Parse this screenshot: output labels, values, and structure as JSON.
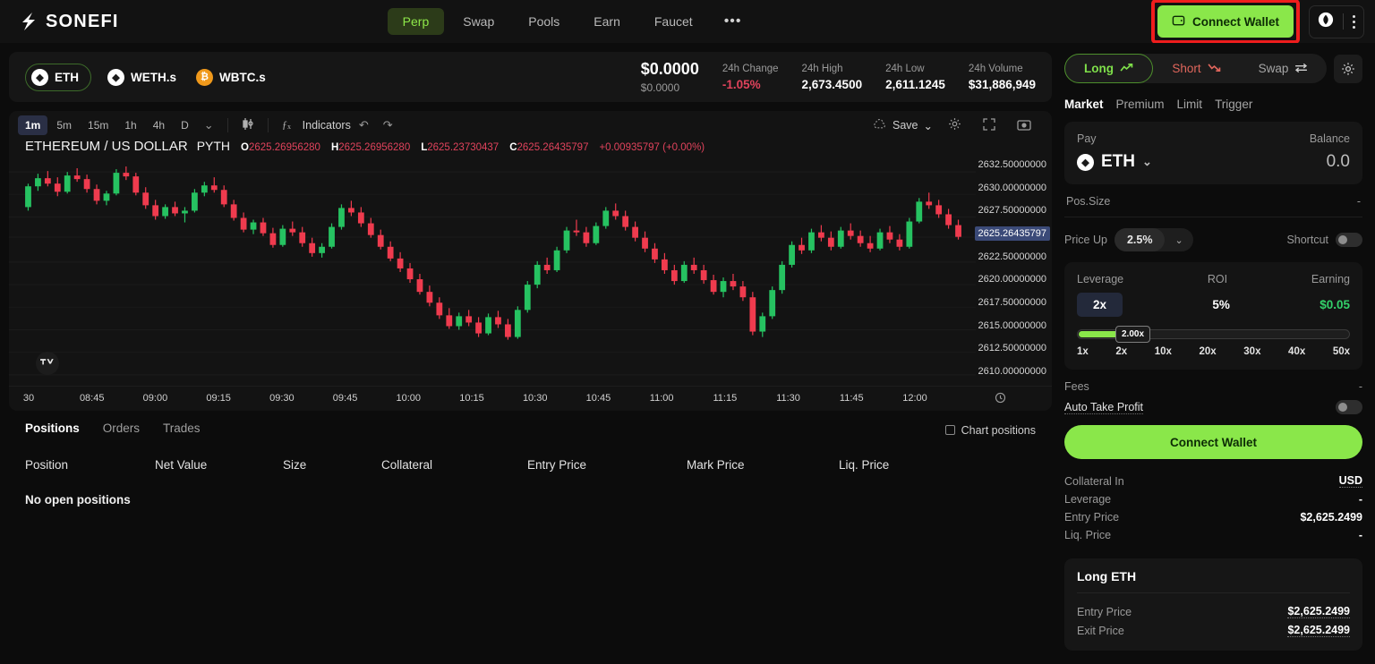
{
  "nav": {
    "brand": "SONEFI",
    "tabs": [
      {
        "label": "Perp",
        "active": true
      },
      {
        "label": "Swap",
        "active": false
      },
      {
        "label": "Pools",
        "active": false
      },
      {
        "label": "Earn",
        "active": false
      },
      {
        "label": "Faucet",
        "active": false
      }
    ],
    "more": "•••",
    "connect_wallet": "Connect Wallet",
    "wallet_icon": "wallet-icon",
    "network_icon": "network-icon",
    "kebab_icon": "kebab-menu-icon",
    "accent": "#8ae74a",
    "highlight_color": "#ef1d1d"
  },
  "market": {
    "tokens": [
      {
        "symbol": "ETH",
        "icon": "ethereum-icon",
        "active": true
      },
      {
        "symbol": "WETH.s",
        "icon": "ethereum-icon",
        "active": false
      },
      {
        "symbol": "WBTC.s",
        "icon": "bitcoin-icon",
        "active": false
      }
    ],
    "price": "$0.0000",
    "price_sub": "$0.0000",
    "stats": [
      {
        "label": "24h Change",
        "value": "-1.05%",
        "negative": true
      },
      {
        "label": "24h High",
        "value": "2,673.4500",
        "negative": false
      },
      {
        "label": "24h Low",
        "value": "2,611.1245",
        "negative": false
      },
      {
        "label": "24h Volume",
        "value": "$31,886,949",
        "negative": false
      }
    ]
  },
  "chart": {
    "timeframes": [
      {
        "label": "1m",
        "active": true
      },
      {
        "label": "5m",
        "active": false
      },
      {
        "label": "15m",
        "active": false
      },
      {
        "label": "1h",
        "active": false
      },
      {
        "label": "4h",
        "active": false
      },
      {
        "label": "D",
        "active": false
      }
    ],
    "caret": "⌄",
    "candle_icon": "candlestick-style-icon",
    "fx_icon": "fx-icon",
    "indicators": "Indicators",
    "undo_icon": "undo-icon",
    "redo_icon": "redo-icon",
    "save": "Save",
    "cloud_icon": "cloud-icon",
    "save_caret": "⌄",
    "settings_icon": "gear-icon",
    "fullscreen_icon": "fullscreen-icon",
    "camera_icon": "camera-icon",
    "legend_symbol": "ETHEREUM / US DOLLAR",
    "legend_source": "PYTH",
    "ohlc": {
      "o_label": "O",
      "o": "2625.26956280",
      "h_label": "H",
      "h": "2625.26956280",
      "l_label": "L",
      "l": "2625.23730437",
      "c_label": "C",
      "c": "2625.26435797",
      "change": "+0.00935797 (+0.00%)"
    },
    "current_price": "2625.26435797",
    "tv_logo": "tradingview-logo",
    "clock_icon": "timezone-clock-icon"
  },
  "chart_data": {
    "type": "candlestick",
    "title": "ETHEREUM / US DOLLAR · PYTH · 1m",
    "xlabel": "",
    "ylabel": "",
    "ylim": [
      2609.0,
      2633.5
    ],
    "price_ticks": [
      "2632.50000000",
      "2630.00000000",
      "2627.50000000",
      "2625.26435797",
      "2622.50000000",
      "2620.00000000",
      "2617.50000000",
      "2615.00000000",
      "2612.50000000",
      "2610.00000000"
    ],
    "time_ticks": [
      "30",
      "08:45",
      "09:00",
      "09:15",
      "09:30",
      "09:45",
      "10:00",
      "10:15",
      "10:30",
      "10:45",
      "11:00",
      "11:15",
      "11:30",
      "11:45",
      "12:00"
    ],
    "up_color": "#26c261",
    "down_color": "#ef3churchill",
    "ohlc_series": [
      [
        2628.6,
        2631.2,
        2628.2,
        2630.9
      ],
      [
        2630.9,
        2632.3,
        2630.4,
        2631.8
      ],
      [
        2631.8,
        2632.6,
        2630.9,
        2631.2
      ],
      [
        2631.2,
        2631.9,
        2629.8,
        2630.3
      ],
      [
        2630.3,
        2632.5,
        2630.1,
        2632.1
      ],
      [
        2632.1,
        2632.9,
        2631.4,
        2631.7
      ],
      [
        2631.7,
        2632.2,
        2630.2,
        2630.6
      ],
      [
        2630.6,
        2631.1,
        2628.9,
        2629.3
      ],
      [
        2629.3,
        2630.4,
        2628.8,
        2630.1
      ],
      [
        2630.1,
        2632.8,
        2629.9,
        2632.4
      ],
      [
        2632.4,
        2633.1,
        2631.6,
        2632.0
      ],
      [
        2632.0,
        2632.4,
        2629.9,
        2630.2
      ],
      [
        2630.2,
        2630.8,
        2628.4,
        2628.8
      ],
      [
        2628.8,
        2629.4,
        2627.2,
        2627.6
      ],
      [
        2627.6,
        2628.9,
        2627.3,
        2628.6
      ],
      [
        2628.6,
        2629.2,
        2627.6,
        2627.9
      ],
      [
        2627.9,
        2628.6,
        2626.9,
        2628.2
      ],
      [
        2628.2,
        2630.6,
        2628.0,
        2630.2
      ],
      [
        2630.2,
        2631.4,
        2629.8,
        2631.0
      ],
      [
        2631.0,
        2631.9,
        2630.2,
        2630.5
      ],
      [
        2630.5,
        2631.0,
        2628.6,
        2628.9
      ],
      [
        2628.9,
        2629.4,
        2627.1,
        2627.4
      ],
      [
        2627.4,
        2628.0,
        2625.8,
        2626.1
      ],
      [
        2626.1,
        2627.2,
        2625.6,
        2626.9
      ],
      [
        2626.9,
        2627.4,
        2625.4,
        2625.7
      ],
      [
        2625.7,
        2626.3,
        2624.1,
        2624.4
      ],
      [
        2624.4,
        2626.6,
        2624.2,
        2626.2
      ],
      [
        2626.2,
        2627.0,
        2625.4,
        2625.8
      ],
      [
        2625.8,
        2626.4,
        2624.2,
        2624.6
      ],
      [
        2624.6,
        2625.2,
        2623.1,
        2623.5
      ],
      [
        2623.5,
        2624.6,
        2623.0,
        2624.2
      ],
      [
        2624.2,
        2626.8,
        2624.0,
        2626.4
      ],
      [
        2626.4,
        2628.9,
        2626.1,
        2628.5
      ],
      [
        2628.5,
        2629.3,
        2627.6,
        2628.0
      ],
      [
        2628.0,
        2628.6,
        2626.4,
        2626.8
      ],
      [
        2626.8,
        2627.4,
        2625.2,
        2625.5
      ],
      [
        2625.5,
        2626.1,
        2623.9,
        2624.2
      ],
      [
        2624.2,
        2624.8,
        2622.6,
        2622.9
      ],
      [
        2622.9,
        2623.6,
        2621.4,
        2621.8
      ],
      [
        2621.8,
        2622.4,
        2620.2,
        2620.6
      ],
      [
        2620.6,
        2621.2,
        2618.9,
        2619.2
      ],
      [
        2619.2,
        2619.9,
        2617.6,
        2618.0
      ],
      [
        2618.0,
        2618.6,
        2616.2,
        2616.6
      ],
      [
        2616.6,
        2617.4,
        2615.1,
        2615.4
      ],
      [
        2615.4,
        2616.9,
        2615.0,
        2616.5
      ],
      [
        2616.5,
        2617.2,
        2615.4,
        2615.8
      ],
      [
        2615.8,
        2616.4,
        2614.2,
        2614.6
      ],
      [
        2614.6,
        2616.8,
        2614.4,
        2616.4
      ],
      [
        2616.4,
        2617.1,
        2615.2,
        2615.6
      ],
      [
        2615.6,
        2616.2,
        2613.9,
        2614.2
      ],
      [
        2614.2,
        2617.6,
        2614.0,
        2617.2
      ],
      [
        2617.2,
        2620.4,
        2616.9,
        2620.0
      ],
      [
        2620.0,
        2622.6,
        2619.6,
        2622.2
      ],
      [
        2622.2,
        2623.0,
        2621.2,
        2621.6
      ],
      [
        2621.6,
        2624.2,
        2621.4,
        2623.8
      ],
      [
        2623.8,
        2626.4,
        2623.5,
        2626.0
      ],
      [
        2626.0,
        2627.2,
        2625.4,
        2625.8
      ],
      [
        2625.8,
        2626.4,
        2624.2,
        2624.6
      ],
      [
        2624.6,
        2626.9,
        2624.4,
        2626.5
      ],
      [
        2626.5,
        2628.6,
        2626.2,
        2628.2
      ],
      [
        2628.2,
        2629.0,
        2627.2,
        2627.6
      ],
      [
        2627.6,
        2628.2,
        2626.0,
        2626.4
      ],
      [
        2626.4,
        2627.0,
        2624.8,
        2625.2
      ],
      [
        2625.2,
        2625.9,
        2623.6,
        2624.0
      ],
      [
        2624.0,
        2624.6,
        2622.4,
        2622.8
      ],
      [
        2622.8,
        2623.5,
        2621.2,
        2621.6
      ],
      [
        2621.6,
        2622.2,
        2620.0,
        2620.4
      ],
      [
        2620.4,
        2622.6,
        2620.2,
        2622.2
      ],
      [
        2622.2,
        2623.0,
        2621.2,
        2621.6
      ],
      [
        2621.6,
        2622.2,
        2620.1,
        2620.5
      ],
      [
        2620.5,
        2621.1,
        2618.9,
        2619.2
      ],
      [
        2619.2,
        2620.8,
        2618.6,
        2620.4
      ],
      [
        2620.4,
        2621.2,
        2619.4,
        2619.8
      ],
      [
        2619.8,
        2620.4,
        2618.2,
        2618.6
      ],
      [
        2618.6,
        2619.2,
        2614.4,
        2614.8
      ],
      [
        2614.8,
        2616.9,
        2614.2,
        2616.5
      ],
      [
        2616.5,
        2619.8,
        2616.2,
        2619.4
      ],
      [
        2619.4,
        2622.6,
        2619.0,
        2622.2
      ],
      [
        2622.2,
        2624.8,
        2621.9,
        2624.4
      ],
      [
        2624.4,
        2625.2,
        2623.4,
        2623.8
      ],
      [
        2623.8,
        2626.2,
        2623.5,
        2625.8
      ],
      [
        2625.8,
        2626.6,
        2624.8,
        2625.2
      ],
      [
        2625.2,
        2625.9,
        2623.8,
        2624.2
      ],
      [
        2624.2,
        2626.4,
        2624.0,
        2626.0
      ],
      [
        2626.0,
        2626.8,
        2625.0,
        2625.4
      ],
      [
        2625.4,
        2626.0,
        2624.2,
        2624.6
      ],
      [
        2624.6,
        2625.4,
        2623.6,
        2624.0
      ],
      [
        2624.0,
        2626.2,
        2623.8,
        2625.8
      ],
      [
        2625.8,
        2626.5,
        2624.6,
        2625.0
      ],
      [
        2625.0,
        2625.6,
        2623.8,
        2624.2
      ],
      [
        2624.2,
        2627.4,
        2624.0,
        2627.0
      ],
      [
        2627.0,
        2629.6,
        2626.8,
        2629.2
      ],
      [
        2629.2,
        2630.2,
        2628.4,
        2628.8
      ],
      [
        2628.8,
        2629.4,
        2627.4,
        2627.8
      ],
      [
        2627.8,
        2628.4,
        2626.2,
        2626.6
      ],
      [
        2626.6,
        2627.2,
        2625.0,
        2625.3
      ]
    ]
  },
  "positions": {
    "tabs": [
      {
        "label": "Positions",
        "active": true
      },
      {
        "label": "Orders",
        "active": false
      },
      {
        "label": "Trades",
        "active": false
      }
    ],
    "chart_positions": "Chart positions",
    "columns": [
      "Position",
      "Net Value",
      "Size",
      "Collateral",
      "Entry Price",
      "Mark Price",
      "Liq. Price"
    ],
    "empty": "No open positions"
  },
  "trade": {
    "sides": [
      {
        "label": "Long",
        "icon": "trend-up-icon",
        "active": true
      },
      {
        "label": "Short",
        "icon": "trend-down-icon",
        "active": false
      },
      {
        "label": "Swap",
        "icon": "swap-arrows-icon",
        "active": false
      }
    ],
    "settings_icon": "gear-icon",
    "order_types": [
      {
        "label": "Market",
        "active": true
      },
      {
        "label": "Premium",
        "active": false
      },
      {
        "label": "Limit",
        "active": false
      },
      {
        "label": "Trigger",
        "active": false
      }
    ],
    "pay_label": "Pay",
    "balance_label": "Balance",
    "pay_token": "ETH",
    "pay_token_icon": "ethereum-icon",
    "pay_caret": "⌄",
    "balance_value": "0.0",
    "pos_size_label": "Pos.Size",
    "pos_size_value": "-",
    "price_up_label": "Price Up",
    "price_up_value": "2.5%",
    "shortcut_label": "Shortcut",
    "leverage_label": "Leverage",
    "roi_label": "ROI",
    "earning_label": "Earning",
    "leverage_value": "2x",
    "roi_value": "5%",
    "earning_value": "$0.05",
    "slider_knob": "2.00x",
    "leverage_scale": [
      "1x",
      "2x",
      "10x",
      "20x",
      "30x",
      "40x",
      "50x"
    ],
    "fees_label": "Fees",
    "fees_value": "-",
    "auto_take_profit": "Auto Take Profit",
    "connect_wallet": "Connect Wallet",
    "summary": [
      {
        "key": "Collateral In",
        "value": "USD",
        "dotted": true
      },
      {
        "key": "Leverage",
        "value": "-",
        "dotted": false
      },
      {
        "key": "Entry Price",
        "value": "$2,625.2499",
        "dotted": false
      },
      {
        "key": "Liq. Price",
        "value": "-",
        "dotted": false
      }
    ],
    "long_card_title": "Long ETH",
    "long_card_rows": [
      {
        "key": "Entry Price",
        "value": "$2,625.2499",
        "dotted": true
      },
      {
        "key": "Exit Price",
        "value": "$2,625.2499",
        "dotted": true
      }
    ]
  }
}
